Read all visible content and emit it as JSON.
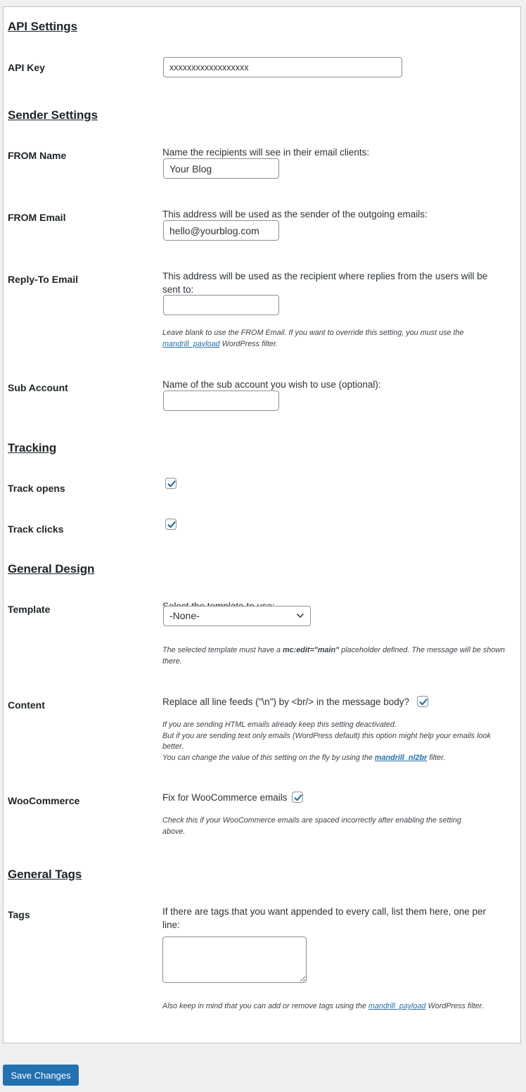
{
  "sections": {
    "api": "API Settings",
    "sender": "Sender Settings",
    "tracking": "Tracking",
    "design": "General Design",
    "tags": "General Tags"
  },
  "api_key": {
    "label": "API Key",
    "value": "xxxxxxxxxxxxxxxxxx"
  },
  "from_name": {
    "label": "FROM Name",
    "desc": "Name the recipients will see in their email clients:",
    "value": "Your Blog"
  },
  "from_email": {
    "label": "FROM Email",
    "desc": "This address will be used as the sender of the outgoing emails:",
    "value": "hello@yourblog.com"
  },
  "reply_to": {
    "label": "Reply-To Email",
    "desc": "This address will be used as the recipient where replies from the users will be sent to:",
    "value": "",
    "note_before": "Leave blank to use the FROM Email. If you want to override this setting, you must use the ",
    "note_link": "mandrill_payload",
    "note_after": " WordPress filter."
  },
  "sub_account": {
    "label": "Sub Account",
    "desc": "Name of the sub account you wish to use (optional):",
    "value": ""
  },
  "track_opens": {
    "label": "Track opens",
    "checked": true
  },
  "track_clicks": {
    "label": "Track clicks",
    "checked": true
  },
  "template": {
    "label": "Template",
    "desc": "Select the template to use:",
    "selected": "-None-",
    "note_before": "The selected template must have a ",
    "note_bold": "mc:edit=\"main\"",
    "note_after": " placeholder defined. The message will be shown there."
  },
  "content": {
    "label": "Content",
    "desc": "Replace all line feeds (\"\\n\") by <br/> in the message body?",
    "checked": true,
    "note_line1": "If you are sending HTML emails already keep this setting deactivated.",
    "note_line2": "But if you are sending text only emails (WordPress default) this option might help your emails look better.",
    "note_line3_before": "You can change the value of this setting on the fly by using the ",
    "note_link": "mandrill_nl2br",
    "note_line3_after": " filter."
  },
  "woocommerce": {
    "label": "WooCommerce",
    "desc": "Fix for WooCommerce emails",
    "checked": true,
    "note": "Check this if your WooCommerce emails are spaced incorrectly after enabling the setting above."
  },
  "tags": {
    "label": "Tags",
    "desc": "If there are tags that you want appended to every call, list them here, one per line:",
    "value": "",
    "note_before": "Also keep in mind that you can add or remove tags using the ",
    "note_link": "mandrill_payload",
    "note_after": " WordPress filter."
  },
  "save_label": "Save Changes",
  "colors": {
    "accent": "#2271b1",
    "check": "#2271b1"
  }
}
